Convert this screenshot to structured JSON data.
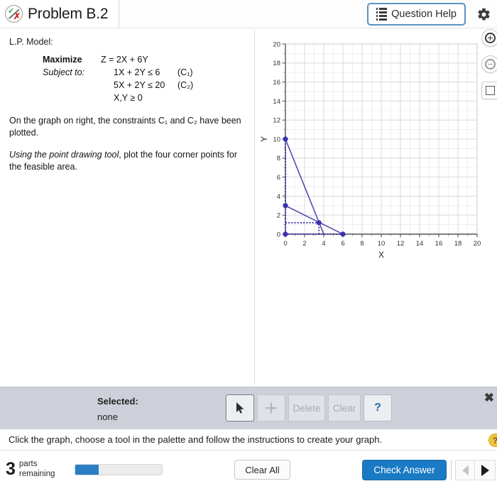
{
  "header": {
    "status_icon": "check-x-icon",
    "title": "Problem B.2",
    "question_help_label": "Question Help",
    "help_icon": "list-icon",
    "settings_icon": "gear-icon"
  },
  "problem": {
    "model_heading": "L.P. Model:",
    "rows": [
      {
        "label": "Maximize",
        "expr": "Z = 2X + 6Y",
        "tag": ""
      },
      {
        "label": "Subject to:",
        "expr": "1X + 2Y ≤ 6",
        "tag": "(C₁)"
      },
      {
        "label": "",
        "expr": "5X + 2Y ≤ 20",
        "tag": "(C₂)"
      },
      {
        "label": "",
        "expr": "X,Y ≥ 0",
        "tag": ""
      }
    ],
    "paragraph1": "On the graph on right, the constraints C₁ and C₂ have been plotted.",
    "paragraph2_italic": "Using the point drawing tool",
    "paragraph2_rest": ", plot the four corner points for the feasible area."
  },
  "chart_data": {
    "type": "line",
    "title": "",
    "xlabel": "X",
    "ylabel": "Y",
    "xlim": [
      0,
      20
    ],
    "ylim": [
      0,
      20
    ],
    "xticks": [
      0,
      2,
      4,
      6,
      8,
      10,
      12,
      14,
      16,
      18,
      20
    ],
    "yticks": [
      0,
      2,
      4,
      6,
      8,
      10,
      12,
      14,
      16,
      18,
      20
    ],
    "minor_tick_step": 1,
    "grid": true,
    "legend": "none",
    "line_color": "#4a42a8",
    "point_color": "#3b31b0",
    "series": [
      {
        "name": "C2: 5X + 2Y = 20",
        "points": [
          [
            0,
            10
          ],
          [
            4,
            0
          ]
        ]
      },
      {
        "name": "C1: 1X + 2Y = 6",
        "points": [
          [
            0,
            3
          ],
          [
            6,
            0
          ]
        ]
      }
    ],
    "plotted_points": [
      [
        0,
        10
      ],
      [
        0,
        3
      ],
      [
        3.5,
        1.2
      ],
      [
        6,
        0
      ],
      [
        0,
        0
      ]
    ],
    "guide_lines": [
      {
        "from": [
          0,
          1.2
        ],
        "to": [
          3.5,
          1.2
        ],
        "style": "dotted"
      },
      {
        "from": [
          3.5,
          0
        ],
        "to": [
          3.5,
          1.2
        ],
        "style": "dotted"
      },
      {
        "from": [
          0,
          0
        ],
        "to": [
          6,
          0
        ],
        "style": "dotted"
      },
      {
        "from": [
          0,
          0
        ],
        "to": [
          0,
          10
        ],
        "style": "dotted"
      }
    ]
  },
  "graph_tools": {
    "zoom_in": "zoom-in-icon",
    "zoom_out": "zoom-out-icon",
    "reset_view": "square-icon"
  },
  "palette": {
    "selected_label": "Selected:",
    "selected_value": "none",
    "tools": [
      {
        "name": "pointer-tool",
        "glyph": "➤",
        "state": "active"
      },
      {
        "name": "point-tool",
        "glyph": "point",
        "state": "disabled"
      },
      {
        "name": "delete-tool",
        "glyph": "Delete",
        "state": "disabled"
      },
      {
        "name": "clear-tool",
        "glyph": "Clear",
        "state": "disabled"
      },
      {
        "name": "help-tool",
        "glyph": "?",
        "state": "enabled"
      }
    ],
    "close_label": "✖"
  },
  "instruction": {
    "text": "Click the graph, choose a tool in the palette and follow the instructions to create your graph.",
    "help_badge": "?"
  },
  "footer": {
    "parts_count": "3",
    "parts_line1": "parts",
    "parts_line2": "remaining",
    "progress_percent": 27,
    "clear_all_label": "Clear All",
    "check_answer_label": "Check Answer",
    "prev_icon": "triangle-left-icon",
    "next_icon": "triangle-right-icon"
  },
  "colors": {
    "accent_blue": "#1a7ac4",
    "plot_purple": "#3b31b0",
    "palette_gray": "#cdd0d8"
  }
}
